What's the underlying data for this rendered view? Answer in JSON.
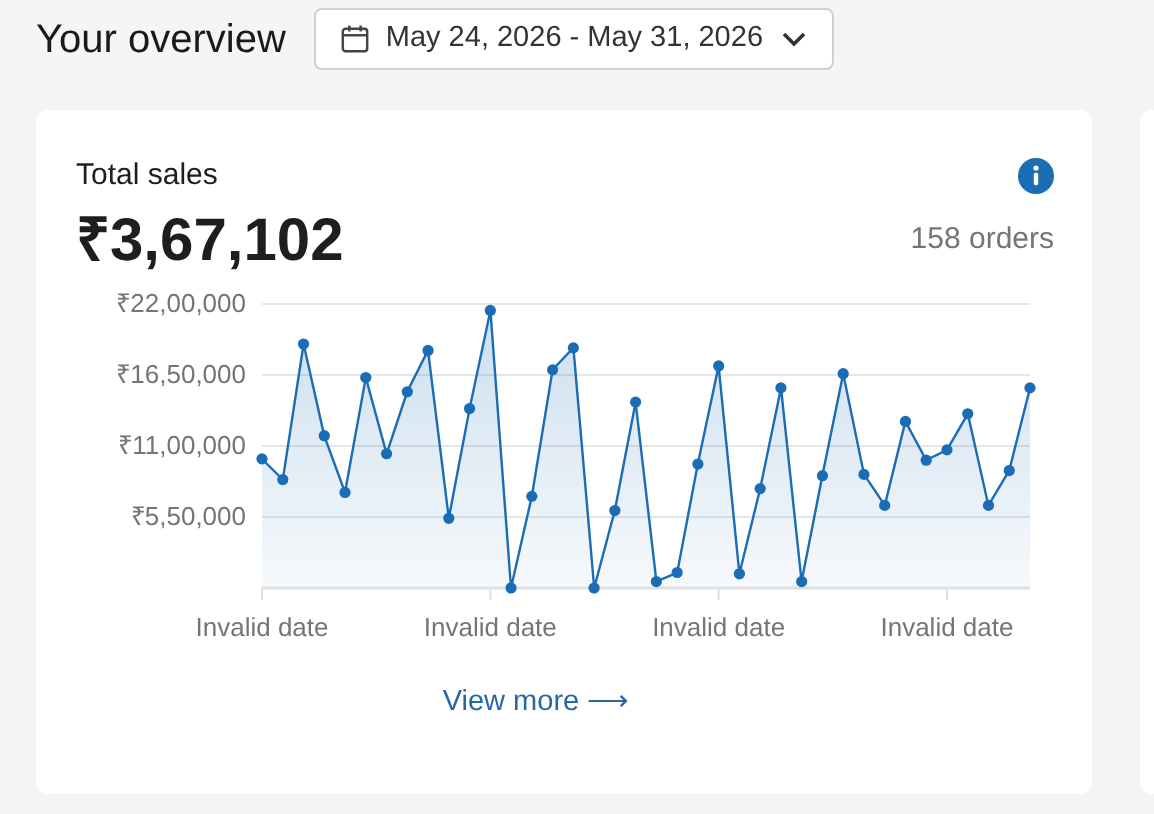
{
  "header": {
    "title": "Your overview",
    "date_range": "May 24, 2026 - May 31, 2026"
  },
  "sales_card": {
    "title": "Total sales",
    "total": "₹3,67,102",
    "orders": "158 orders",
    "link": "View more",
    "link_arrow": "⟶",
    "chart_data": {
      "type": "area",
      "ylim": [
        0,
        2200000
      ],
      "yticks": [
        {
          "value": 550000,
          "label": "₹5,50,000"
        },
        {
          "value": 1100000,
          "label": "₹11,00,000"
        },
        {
          "value": 1650000,
          "label": "₹16,50,000"
        },
        {
          "value": 2200000,
          "label": "₹22,00,000"
        }
      ],
      "grid": true,
      "categories": [
        "Invalid date",
        null,
        null,
        null,
        null,
        null,
        null,
        null,
        null,
        null,
        null,
        "Invalid date",
        null,
        null,
        null,
        null,
        null,
        null,
        null,
        null,
        null,
        null,
        "Invalid date",
        null,
        null,
        null,
        null,
        null,
        null,
        null,
        null,
        null,
        null,
        "Invalid date",
        null,
        null,
        null,
        null
      ],
      "series": [
        {
          "color": "#1a6cb5",
          "values": [
            1000000,
            840000,
            1890000,
            1180000,
            740000,
            1630000,
            1040000,
            1520000,
            1840000,
            540000,
            1390000,
            2150000,
            0,
            710000,
            1690000,
            1860000,
            0,
            600000,
            1440000,
            50000,
            120000,
            960000,
            1720000,
            110000,
            770000,
            1550000,
            50000,
            870000,
            1660000,
            880000,
            640000,
            1290000,
            990000,
            1070000,
            1350000,
            640000,
            910000,
            1550000
          ]
        }
      ]
    }
  }
}
